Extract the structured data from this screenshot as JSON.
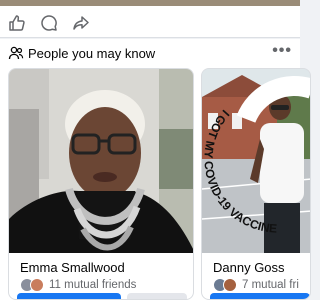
{
  "section": {
    "title": "People you may know",
    "more_label": "•••"
  },
  "cards": [
    {
      "name": "Emma Smallwood",
      "mutual": "11 mutual friends"
    },
    {
      "name": "Danny Goss",
      "mutual": "7 mutual fri",
      "shirt_text": "I GOT MY COVID-19 VACCINE"
    }
  ],
  "colors": {
    "accent": "#1877f2",
    "secondary_text": "#65676b",
    "divider": "#dadde1"
  },
  "icons": [
    "like-icon",
    "comment-icon",
    "share-icon",
    "people-icon"
  ]
}
